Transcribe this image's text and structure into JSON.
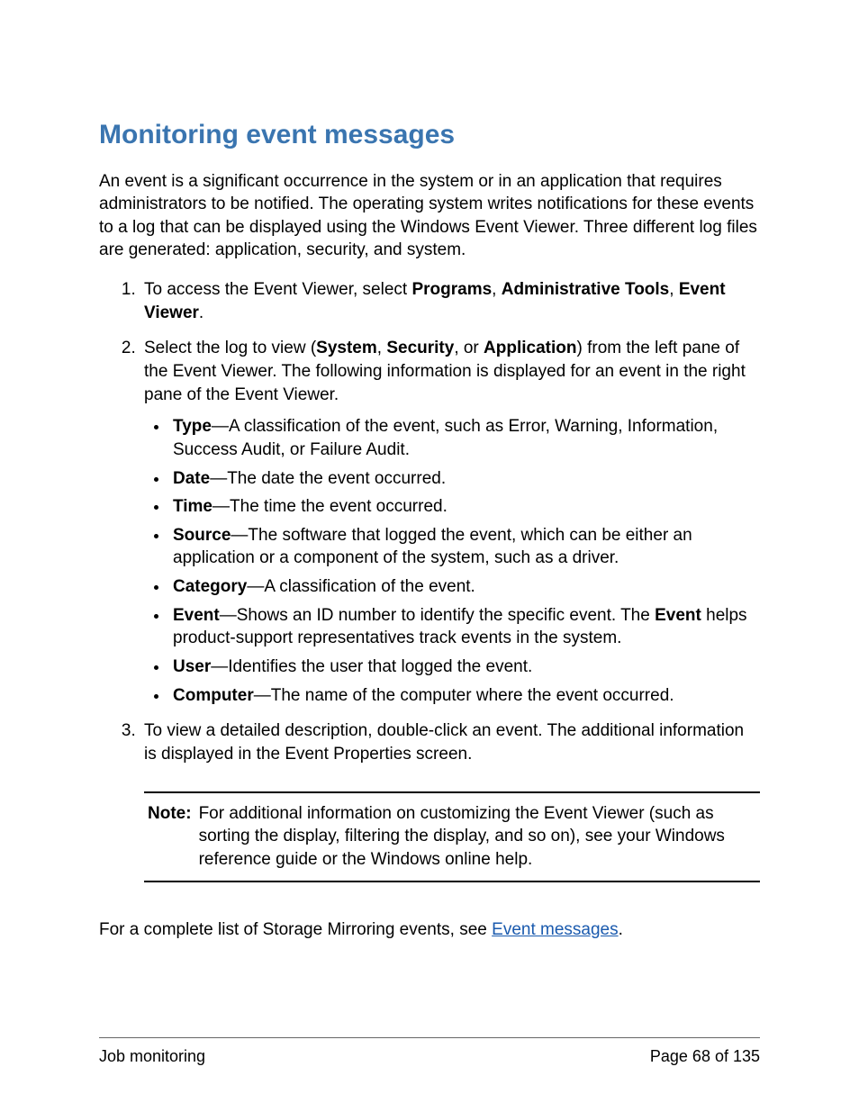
{
  "title": "Monitoring event messages",
  "intro": "An event is a significant occurrence in the system or in an application that requires administrators to be notified. The operating system writes notifications for these events to a log that can be displayed using the Windows Event Viewer. Three different log files are generated: application, security, and system.",
  "steps": {
    "s1": {
      "prefix": "To access the Event Viewer, select ",
      "b1": "Programs",
      "sep1": ", ",
      "b2": "Administrative Tools",
      "sep2": ", ",
      "b3": "Event Viewer",
      "suffix": "."
    },
    "s2": {
      "prefix": "Select the log to view (",
      "b1": "System",
      "sep1": ", ",
      "b2": "Security",
      "sep2": ", or ",
      "b3": "Application",
      "suffix": ") from the left pane of the Event Viewer. The following information is displayed for an event in the right pane of the Event Viewer."
    },
    "s3": "To view a detailed description, double-click an event. The additional information is displayed in the Event Properties screen."
  },
  "defs": {
    "d1": {
      "term": "Type",
      "desc": "—A classification of the event, such as Error, Warning, Information, Success Audit, or Failure Audit."
    },
    "d2": {
      "term": "Date",
      "desc": "—The date the event occurred."
    },
    "d3": {
      "term": "Time",
      "desc": "—The time the event occurred."
    },
    "d4": {
      "term": "Source",
      "desc": "—The software that logged the event, which can be either an application or a component of the system, such as a driver."
    },
    "d5": {
      "term": "Category",
      "desc": "—A classification of the event."
    },
    "d6": {
      "term": "Event",
      "desc_a": "—Shows an ID number to identify the specific event. The ",
      "inner_b": "Event",
      "desc_b": " helps product-support representatives track events in the system."
    },
    "d7": {
      "term": "User",
      "desc": "—Identifies the user that logged the event."
    },
    "d8": {
      "term": "Computer",
      "desc": "—The name of the computer where the event occurred."
    }
  },
  "note": {
    "label": "Note:",
    "text": "For additional information on customizing the Event Viewer (such as sorting the display, filtering the display, and so on), see your Windows reference guide or the Windows online help."
  },
  "closing": {
    "prefix": "For a complete list of Storage Mirroring events, see ",
    "link": "Event messages",
    "suffix": "."
  },
  "footer": {
    "left": "Job monitoring",
    "right": "Page 68 of 135"
  }
}
